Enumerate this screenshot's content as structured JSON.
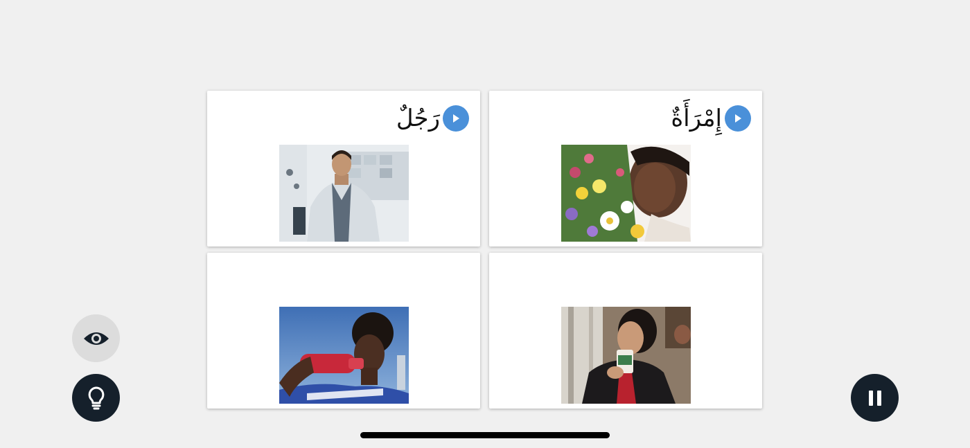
{
  "cards": [
    {
      "word": "رَجُلٌ",
      "has_audio": true,
      "photo": "man-in-lab-coat"
    },
    {
      "word": "إِمْرَأَةٌ",
      "has_audio": true,
      "photo": "woman-smelling-flowers"
    },
    {
      "word": "",
      "has_audio": false,
      "photo": "boy-drinking-from-bottle"
    },
    {
      "word": "",
      "has_audio": false,
      "photo": "woman-drinking-coffee"
    }
  ],
  "controls": {
    "eye_icon": "eye-icon",
    "hint_icon": "lightbulb-icon",
    "pause_icon": "pause-icon"
  },
  "colors": {
    "accent": "#4a90d9",
    "dark_button": "#15202b",
    "light_button": "#dcdcdc",
    "background": "#f0f0f0"
  }
}
